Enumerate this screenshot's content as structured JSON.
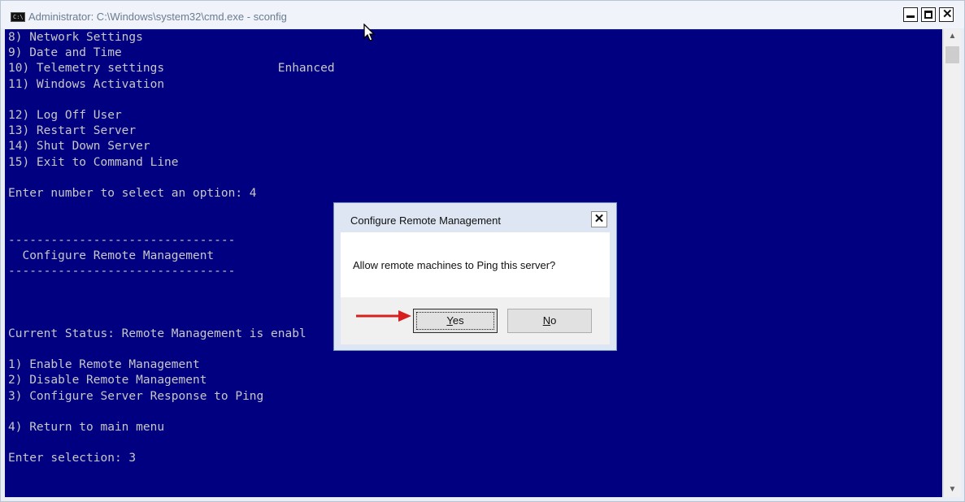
{
  "window": {
    "title": "Administrator: C:\\Windows\\system32\\cmd.exe - sconfig",
    "icon_label": "C:\\",
    "minimize_icon": "minimize-icon",
    "maximize_icon": "maximize-icon",
    "close_icon": "close-icon"
  },
  "console": {
    "lines": [
      "8) Network Settings",
      "9) Date and Time",
      "10) Telemetry settings                Enhanced",
      "11) Windows Activation",
      "",
      "12) Log Off User",
      "13) Restart Server",
      "14) Shut Down Server",
      "15) Exit to Command Line",
      "",
      "Enter number to select an option: 4",
      "",
      "",
      "--------------------------------",
      "  Configure Remote Management",
      "--------------------------------",
      "",
      "",
      "",
      "Current Status: Remote Management is enabl",
      "",
      "1) Enable Remote Management",
      "2) Disable Remote Management",
      "3) Configure Server Response to Ping",
      "",
      "4) Return to main menu",
      "",
      "Enter selection: 3"
    ],
    "colors": {
      "background": "#000080",
      "text": "#c7c7c7"
    }
  },
  "dialog": {
    "title": "Configure Remote Management",
    "message": "Allow remote machines to Ping this server?",
    "yes_label": "Yes",
    "no_label": "No"
  },
  "annotation": {
    "arrow_color": "#d62020"
  }
}
